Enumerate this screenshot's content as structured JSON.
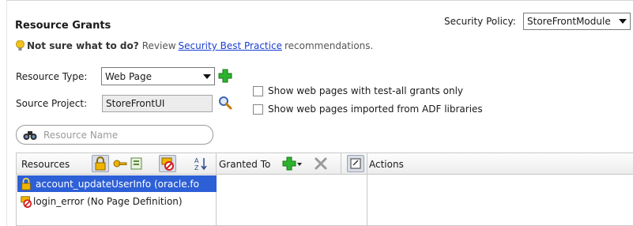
{
  "title": "Resource Grants",
  "security_policy": {
    "label": "Security Policy:",
    "value": "StoreFrontModule"
  },
  "hint": {
    "bold": "Not sure what to do?",
    "before_link": "Review",
    "link": "Security Best Practice",
    "after_link": "recommendations."
  },
  "resource_type": {
    "label": "Resource Type:",
    "value": "Web Page"
  },
  "source_project": {
    "label": "Source Project:",
    "value": "StoreFrontUI"
  },
  "options": [
    {
      "label": "Show web pages with test-all grants only",
      "checked": false
    },
    {
      "label": "Show web pages imported from ADF libraries",
      "checked": false
    }
  ],
  "filter": {
    "placeholder": "Resource Name"
  },
  "table": {
    "resources_header": "Resources",
    "granted_to_header": "Granted To",
    "actions_header": "Actions",
    "rows": [
      {
        "label": "account_updateUserInfo (oracle.fo",
        "icon": "lock-icon",
        "selected": true
      },
      {
        "label": "login_error (No Page Definition)",
        "icon": "no-definition-icon",
        "selected": false
      }
    ]
  },
  "colors": {
    "selection": "#2d5fd6",
    "link": "#1a3fd1",
    "add_green": "#2fb32f"
  }
}
